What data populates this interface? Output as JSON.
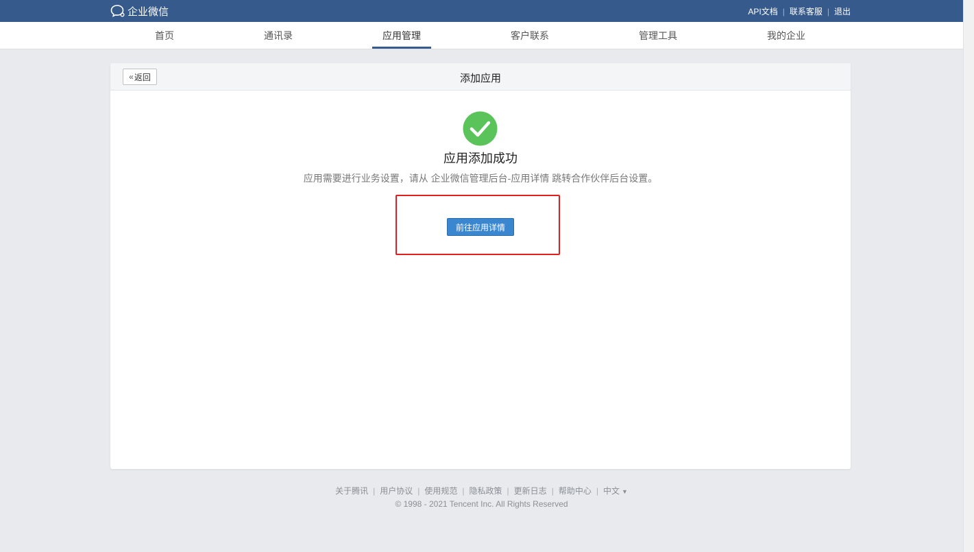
{
  "brand": {
    "name": "企业微信",
    "icon": "chat-bubble-icon"
  },
  "top_links": [
    {
      "label": "API文档"
    },
    {
      "label": "联系客服"
    },
    {
      "label": "退出"
    }
  ],
  "nav": {
    "items": [
      {
        "label": "首页"
      },
      {
        "label": "通讯录"
      },
      {
        "label": "应用管理",
        "active": true
      },
      {
        "label": "客户联系"
      },
      {
        "label": "管理工具"
      },
      {
        "label": "我的企业"
      }
    ]
  },
  "panel": {
    "back_label": "返回",
    "title": "添加应用"
  },
  "result": {
    "icon": "check-circle-icon",
    "title": "应用添加成功",
    "description": "应用需要进行业务设置，请从 企业微信管理后台-应用详情 跳转合作伙伴后台设置。",
    "button_label": "前往应用详情"
  },
  "footer": {
    "links": [
      {
        "label": "关于腾讯"
      },
      {
        "label": "用户协议"
      },
      {
        "label": "使用规范"
      },
      {
        "label": "隐私政策"
      },
      {
        "label": "更新日志"
      },
      {
        "label": "帮助中心"
      }
    ],
    "language": "中文",
    "copyright": "© 1998 - 2021 Tencent Inc. All Rights Reserved"
  },
  "colors": {
    "header_bg": "#355a8b",
    "success_green": "#5ac45a",
    "primary_button": "#3a86cf",
    "highlight_red": "#e02020"
  }
}
